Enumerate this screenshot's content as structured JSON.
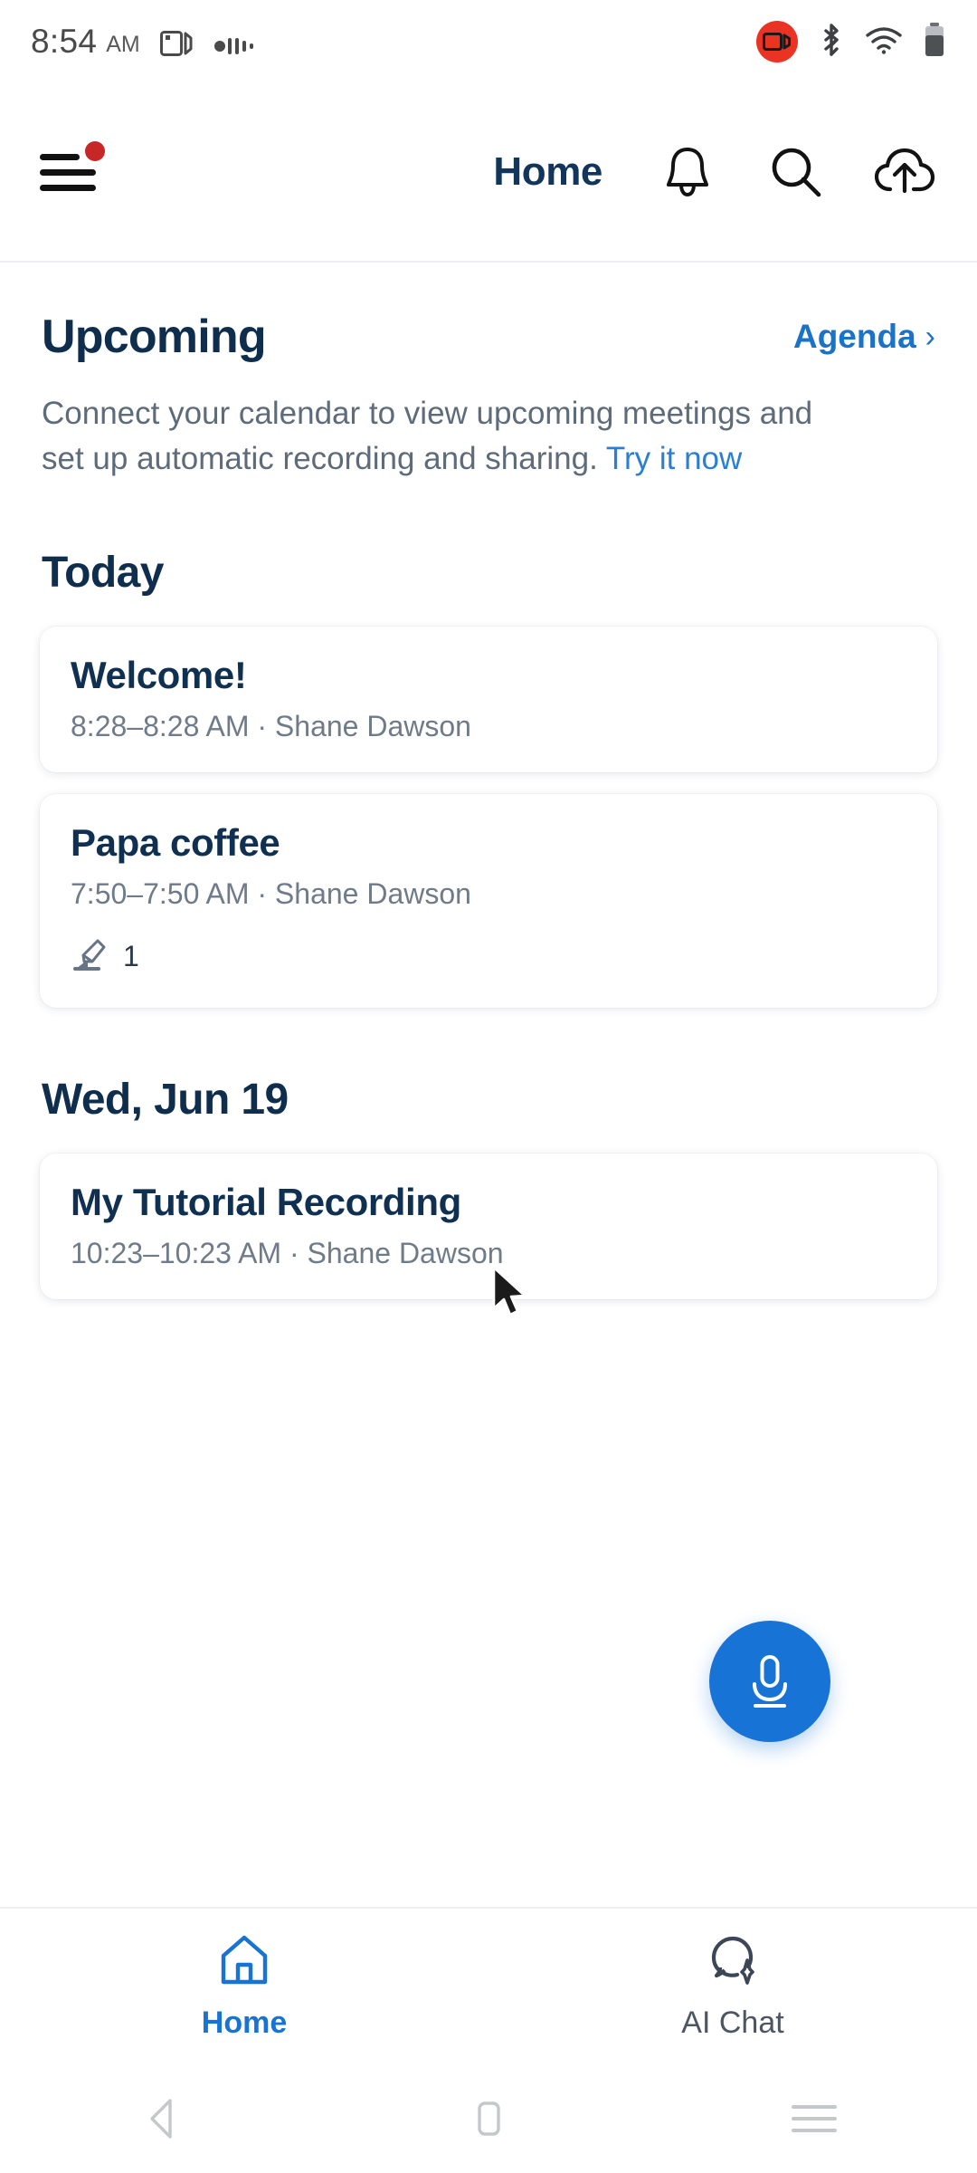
{
  "status_bar": {
    "time": "8:54",
    "ampm": "AM",
    "icons": [
      "screen-cast-icon",
      "audio-wave-icon",
      "screen-record-badge",
      "bluetooth-icon",
      "wifi-icon",
      "battery-icon"
    ]
  },
  "header": {
    "menu_icon": "hamburger-menu-icon",
    "menu_badge": true,
    "title": "Home",
    "actions": [
      "notifications-bell-icon",
      "search-icon",
      "cloud-upload-icon"
    ]
  },
  "upcoming": {
    "title": "Upcoming",
    "agenda_label": "Agenda",
    "agenda_chevron": "›",
    "description_part1": "Connect your calendar to view upcoming meetings and set up automatic recording and sharing. ",
    "description_link": "Try it now"
  },
  "sections": [
    {
      "day_label": "Today",
      "items": [
        {
          "title": "Welcome!",
          "subtitle": "8:28–8:28 AM ·  Shane Dawson",
          "has_meta": false,
          "meta_icon": "",
          "meta_count": ""
        },
        {
          "title": "Papa coffee",
          "subtitle": "7:50–7:50 AM ·  Shane Dawson",
          "has_meta": true,
          "meta_icon": "highlighter-icon",
          "meta_count": "1"
        }
      ]
    },
    {
      "day_label": "Wed, Jun 19",
      "items": [
        {
          "title": "My Tutorial Recording",
          "subtitle": "10:23–10:23 AM ·  Shane Dawson",
          "has_meta": false,
          "meta_icon": "",
          "meta_count": ""
        }
      ]
    }
  ],
  "fab": {
    "icon": "microphone-icon",
    "color": "#1773d6"
  },
  "bottom_nav": {
    "items": [
      {
        "label": "Home",
        "icon": "home-icon",
        "active": true
      },
      {
        "label": "AI Chat",
        "icon": "ai-chat-bubble-icon",
        "active": false
      }
    ]
  },
  "system_nav": {
    "back": "back-triangle-icon",
    "home": "home-square-icon",
    "recents": "recents-lines-icon"
  },
  "colors": {
    "accent_blue": "#1773d6",
    "link_blue": "#2a7fd4",
    "heading_navy": "#0f2d4d",
    "muted_text": "#6f7b88",
    "badge_red": "#c62828"
  }
}
